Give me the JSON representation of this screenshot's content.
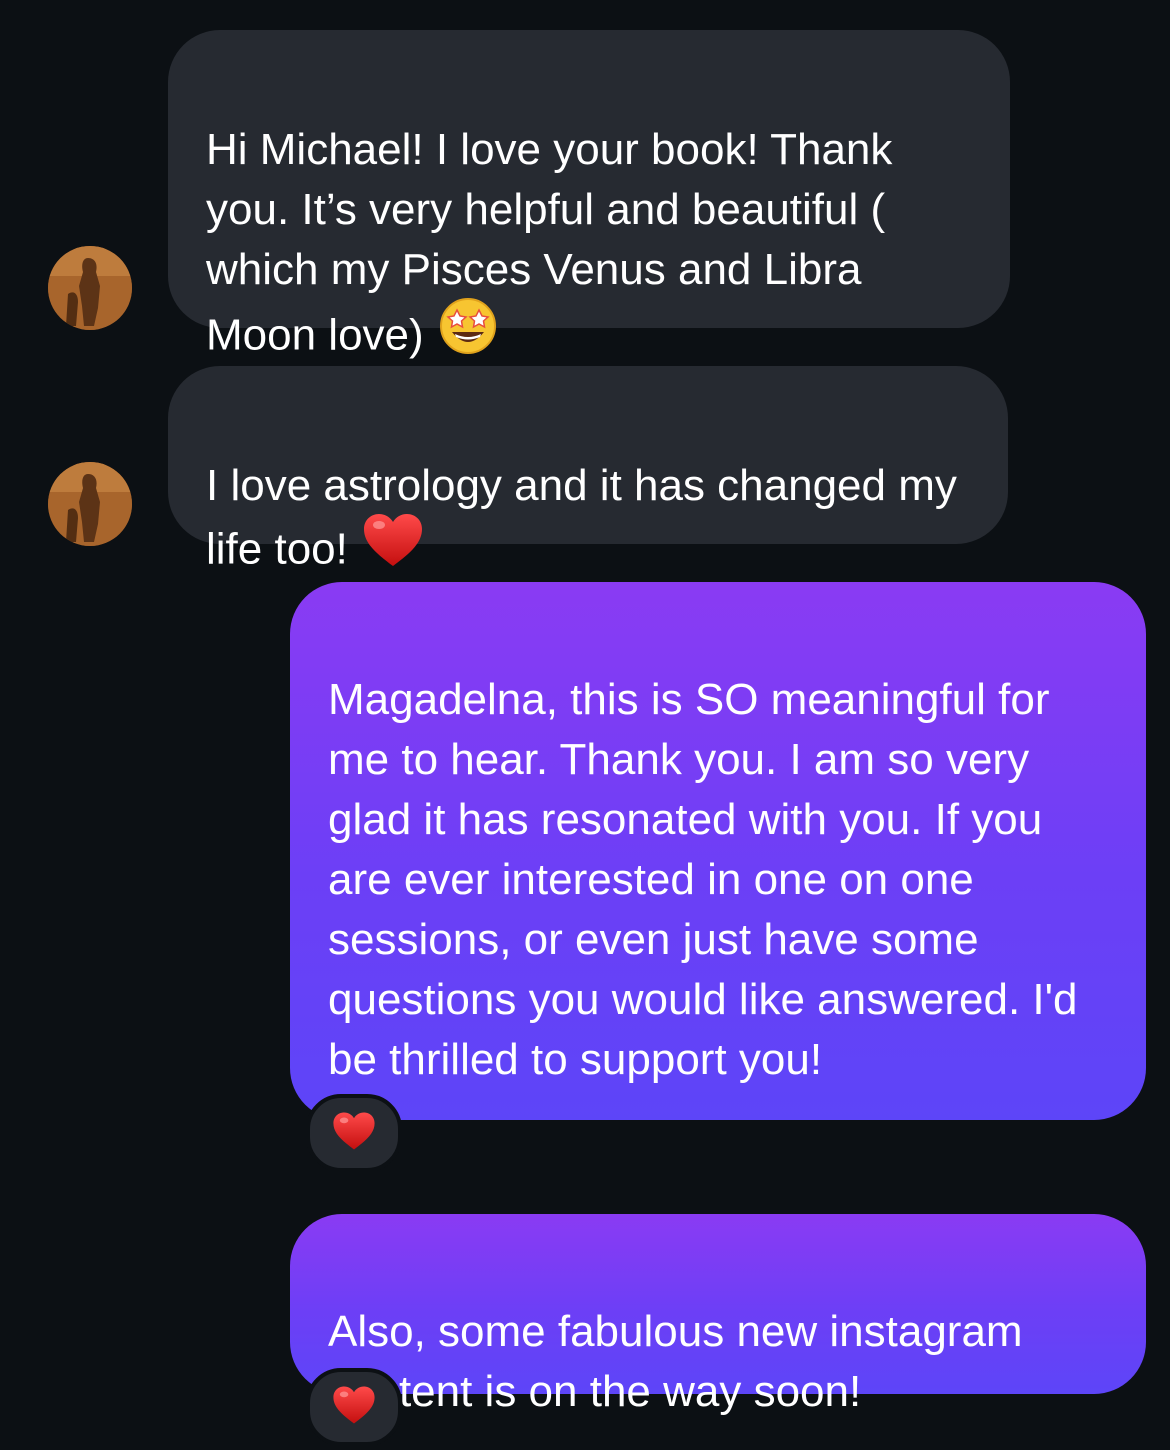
{
  "messages": [
    {
      "direction": "incoming",
      "text": "Hi Michael! I love your book! Thank you. It’s very helpful and beautiful ( which my Pisces Venus and Libra Moon love)",
      "emoji": "star-struck-emoji"
    },
    {
      "direction": "incoming",
      "text": "I love astrology and it has changed my life too!",
      "emoji": "red-heart-emoji"
    },
    {
      "direction": "outgoing",
      "text": "Magadelna, this is SO meaningful for me to hear. Thank you. I am so very glad it has resonated with you. If you are ever interested in one on one sessions, or even just have some questions you would like answered. I'd be thrilled to support you!",
      "reaction": "red-heart-emoji"
    },
    {
      "direction": "outgoing",
      "text": "Also, some fabulous new instagram content is on the way soon!",
      "reaction": "red-heart-emoji"
    }
  ],
  "colors": {
    "background": "#0c1014",
    "incoming_bubble": "#262a31",
    "outgoing_bubble_top": "#8a3bf3",
    "outgoing_bubble_bottom": "#5d45f8",
    "text": "#ffffff"
  }
}
